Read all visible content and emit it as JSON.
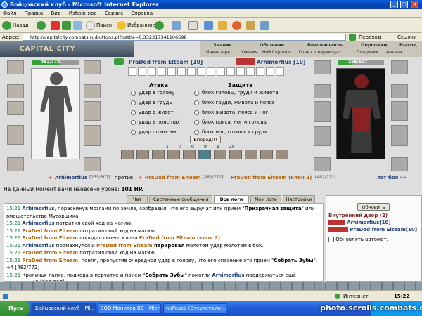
{
  "window": {
    "title": "Бойцовский клуб - Microsoft Internet Explorer"
  },
  "menu": [
    "Файл",
    "Правка",
    "Вид",
    "Избранное",
    "Сервис",
    "Справка"
  ],
  "toolbar": {
    "back": "Назад",
    "search": "Поиск",
    "favorites": "Избранное"
  },
  "address": {
    "label": "Адрес:",
    "url": "http://capitalcity.combats.ru/buttons.pl?battle=0.332317341106698",
    "go": "Переход",
    "links": "Ссылки"
  },
  "site": {
    "logo": "CAPITAL CITY",
    "nav_top": [
      "Знания",
      "Общение",
      "Безопасность",
      "Персонаж",
      "Выход"
    ],
    "nav_bottom": [
      "Инвентарь",
      "Умения",
      "Ной Скроллп",
      "Отчет о переводах",
      "Поединки",
      "Анкета"
    ]
  },
  "battle": {
    "left_hp": "482/772",
    "right_hp": "255/607",
    "left_fighter": "PraDed from Elteam [10]",
    "versus": "против",
    "right_fighter": "Arhimorfius [10]",
    "attack_header": "Атака",
    "defense_header": "Защита",
    "attacks": [
      "удар в голову",
      "удар в грудь",
      "удар в живот",
      "удар в пояс(пах)",
      "удар по ногам"
    ],
    "defenses": [
      "блок головы, груди и живота",
      "блок груди, живота и пояса",
      "блок живота, пояса и ног",
      "блок пояса, ног и головы",
      "блок ног, головы и груди"
    ],
    "forward_button": "Вперед!!!",
    "counters": [
      "1",
      "0",
      "0",
      "0",
      "1",
      "20"
    ],
    "versus_line": {
      "a": "Arhimorfius",
      "a_hp": "[255/607]",
      "vs": "против",
      "b": "PraDed from Elteam",
      "b_hp": "[482/772]",
      "c": "PraDed from Elteam (клон 2)",
      "c_hp": "[482/772]",
      "log": "лог боя »»"
    },
    "damage_msg": "На данный момент вами нанесено урона:",
    "damage_val": "101 HP."
  },
  "tabs": [
    "Чат",
    "Системные сообщения",
    "Все логи",
    "Мои логи",
    "Настройки"
  ],
  "log": [
    {
      "time": "15:21",
      "parts": [
        {
          "c": "blue",
          "t": "Arhimorfius"
        },
        {
          "c": "",
          "t": ", пораскинув мозгами по земле, сообразил, что его выручат или прием \""
        },
        {
          "c": "b",
          "t": "Призрачная защита"
        },
        {
          "c": "",
          "t": "\" или вмешательство Мусорщика."
        }
      ]
    },
    {
      "time": "15:21",
      "parts": [
        {
          "c": "blue",
          "t": "Arhimorfius"
        },
        {
          "c": "",
          "t": " потратил свой ход на магию."
        }
      ]
    },
    {
      "time": "15:21",
      "parts": [
        {
          "c": "orange",
          "t": "PraDed from Elteam"
        },
        {
          "c": "",
          "t": " потратил свой ход на магию."
        }
      ]
    },
    {
      "time": "15:21",
      "parts": [
        {
          "c": "orange",
          "t": "PraDed from Elteam"
        },
        {
          "c": "",
          "t": " породил своего клона "
        },
        {
          "c": "orange",
          "t": "PraDed from Elteam (клон 2)"
        }
      ]
    },
    {
      "time": "15:21",
      "parts": [
        {
          "c": "blue",
          "t": "Arhimorfius"
        },
        {
          "c": "",
          "t": " промахнулся и "
        },
        {
          "c": "orange",
          "t": "PraDed from Elteam"
        },
        {
          "c": "",
          "t": " "
        },
        {
          "c": "b",
          "t": "парировал"
        },
        {
          "c": "",
          "t": " молотом удар молотом в бок."
        }
      ]
    },
    {
      "time": "15:21",
      "parts": [
        {
          "c": "orange",
          "t": "PraDed from Elteam"
        },
        {
          "c": "",
          "t": " потратил свой ход на магию."
        }
      ]
    },
    {
      "time": "15:21",
      "parts": [
        {
          "c": "orange",
          "t": "PraDed from Elteam"
        },
        {
          "c": "",
          "t": ", понял, пропустив очередной удар в голову, что его спасение это прием \""
        },
        {
          "c": "b",
          "t": "Собрать Зубы"
        },
        {
          "c": "",
          "t": "\". +4 [482/772]"
        }
      ]
    },
    {
      "time": "15:21",
      "parts": [
        {
          "c": "",
          "t": "Кроличья лапка, подкова в перчатке и прием \""
        },
        {
          "c": "b",
          "t": "Собрать Зубы"
        },
        {
          "c": "",
          "t": "\" помогли "
        },
        {
          "c": "blue",
          "t": "Arhimorfius"
        },
        {
          "c": "",
          "t": " продержаться ещё немного. +3 [255/607]"
        }
      ]
    }
  ],
  "right_panel": {
    "refresh": "Обновить",
    "location": "Внутренний двор (2)",
    "p1": "Arhimorfius[10]",
    "p2": "PraDed from Elteam[10]",
    "auto": "Обновлять автомат."
  },
  "status": {
    "zone": "Интернет",
    "time": "15:22"
  },
  "taskbar": {
    "start": "Пуск",
    "items": [
      "Бойцовский клуб - Mi...",
      "SOD Монитор ВС - Micro...",
      "noPeace (Отсутствую):..."
    ]
  },
  "watermark": "photo.scrolls.combats.com"
}
